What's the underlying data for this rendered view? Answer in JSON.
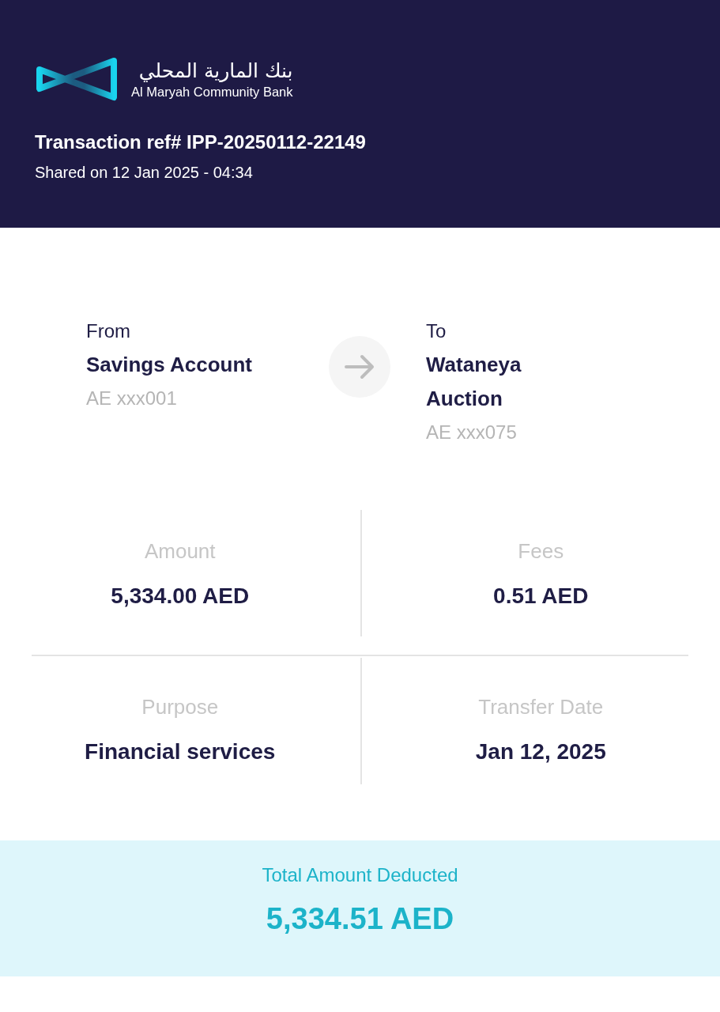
{
  "header": {
    "bank_name_arabic": "بنك المارية المحلي",
    "bank_name": "Al Maryah Community Bank",
    "title": "Transaction ref# IPP-20250112-22149",
    "subtitle": "Shared on 12 Jan 2025 - 04:34"
  },
  "transfer": {
    "from": {
      "label": "From",
      "name": "Savings Account",
      "account": "AE xxx001"
    },
    "to": {
      "label": "To",
      "name": "Wataneya Auction",
      "account": "AE xxx075"
    }
  },
  "details": [
    {
      "label": "Amount",
      "value": "5,334.00 AED"
    },
    {
      "label": "Fees",
      "value": "0.51 AED"
    },
    {
      "label": "Purpose",
      "value": "Financial services"
    },
    {
      "label": "Transfer Date",
      "value": "Jan 12, 2025"
    }
  ],
  "total": {
    "label": "Total Amount Deducted",
    "value": "5,334.51 AED"
  }
}
